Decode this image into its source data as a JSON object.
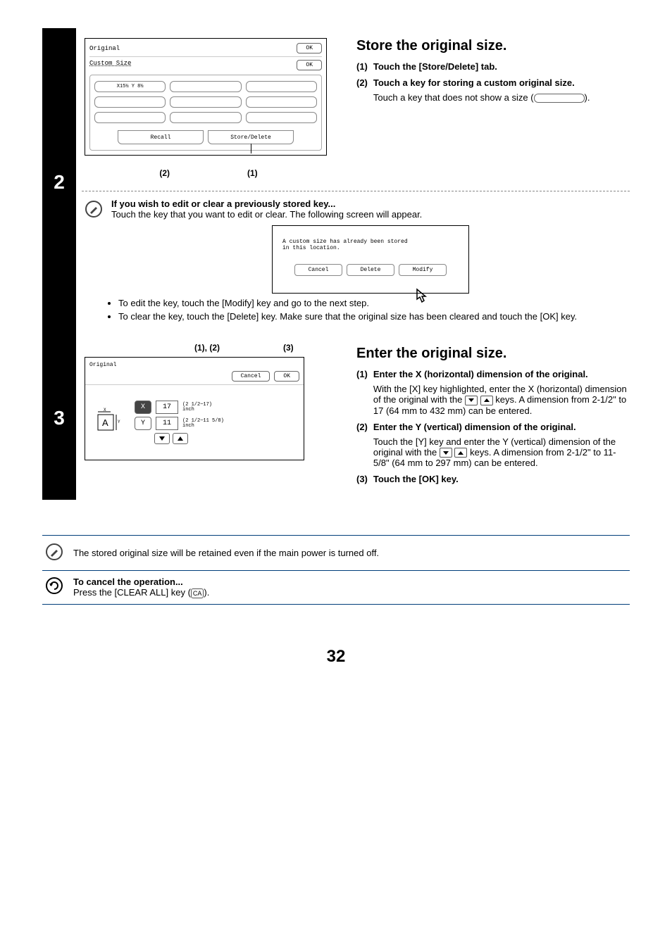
{
  "step2": {
    "ui": {
      "title": "Original",
      "ok": "OK",
      "subtitle": "Custom Size",
      "ok2": "OK",
      "preset": "X15½ Y 8½",
      "tab_recall": "Recall",
      "tab_store": "Store/Delete",
      "call_2": "(2)",
      "call_1": "(1)"
    },
    "heading": "Store the original size.",
    "items": [
      {
        "n": "(1)",
        "bold": "Touch the [Store/Delete] tab."
      },
      {
        "n": "(2)",
        "bold": "Touch a key for storing a custom original size.",
        "light_pre": "Touch a key that does not show a size (",
        "light_post": ")."
      }
    ],
    "note_title": "If you wish to edit or clear a previously stored key...",
    "note_body": "Touch the key that you want to edit or clear. The following screen will appear.",
    "dialog": {
      "msg1": "A custom size has already been stored",
      "msg2": "in this location.",
      "cancel": "Cancel",
      "delete": "Delete",
      "modify": "Modify"
    },
    "bullets": [
      "To edit the key, touch the [Modify] key and go to the next step.",
      "To clear the key, touch the [Delete] key. Make sure that the original size has been cleared and touch the [OK] key."
    ]
  },
  "step3": {
    "call_12": "(1), (2)",
    "call_3": "(3)",
    "ui": {
      "title": "Original",
      "cancel": "Cancel",
      "ok": "OK",
      "x": "X",
      "y": "Y",
      "xv": "17",
      "yv": "11",
      "xrange1": "(2 1/2~17)",
      "xrange2": "inch",
      "yrange1": "(2 1/2~11 5/8)",
      "yrange2": "inch"
    },
    "heading": "Enter the original size.",
    "items": [
      {
        "n": "(1)",
        "bold": "Enter the X (horizontal) dimension of the original.",
        "light_pre": "With the [X] key highlighted, enter the X (horizontal) dimension of the original with the ",
        "light_mid": " keys. A dimension from 2-1/2\" to 17 (64 mm to 432 mm) can be entered."
      },
      {
        "n": "(2)",
        "bold": "Enter the Y (vertical) dimension of the original.",
        "light_pre": "Touch the [Y] key and enter the Y (vertical) dimension of the original with the ",
        "light_mid": " keys. A dimension from 2-1/2\" to 11-5/8\" (64 mm to 297 mm) can be entered."
      },
      {
        "n": "(3)",
        "bold": "Touch the [OK] key."
      }
    ]
  },
  "footnote1": "The stored original size will be retained even if the main power is turned off.",
  "footnote2_title": "To cancel the operation...",
  "footnote2_body_pre": "Press the [CLEAR ALL] key (",
  "footnote2_ca": "CA",
  "footnote2_body_post": ").",
  "pagenum": "32"
}
